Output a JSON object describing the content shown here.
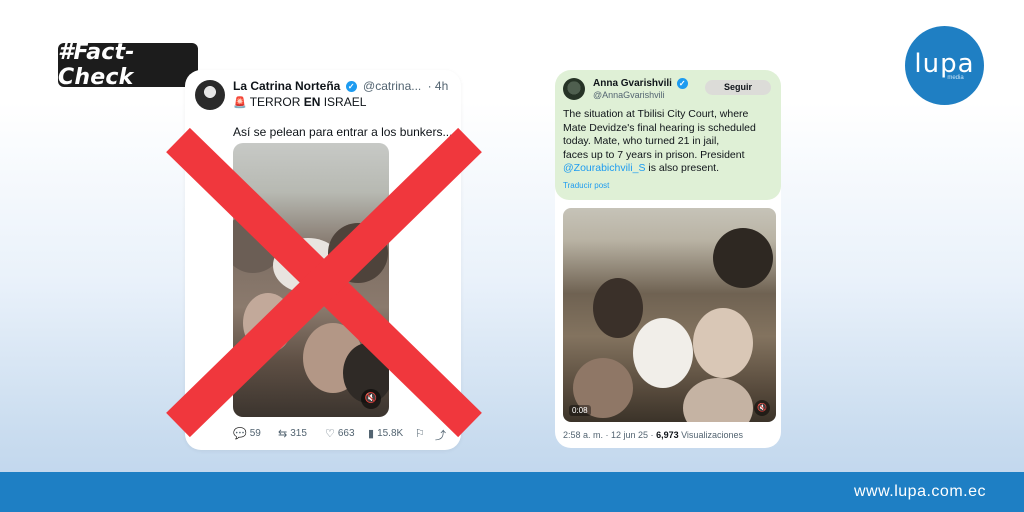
{
  "badge": {
    "label": "#Fact-Check"
  },
  "logo": {
    "name": "lupa",
    "sub": "media"
  },
  "left_post": {
    "display_name": "La Catrina Norteña",
    "handle": "@catrina...",
    "time": "· 4h",
    "line2_prefix": "TERROR ",
    "line2_bold": "EN",
    "line2_suffix": " ISRAEL",
    "body": "Así se pelean para entrar a los bunkers...",
    "replies": "59",
    "reposts": "315",
    "likes": "663",
    "views": "15.8K"
  },
  "right_post": {
    "display_name": "Anna Gvarishvili",
    "handle": "@AnnaGvarishvili",
    "follow_label": "Seguir",
    "body_lines": [
      "The situation at Tbilisi City Court, where",
      "Mate Devidze's final hearing is scheduled",
      "today. Mate, who turned 21 in jail,",
      "faces up to 7 years in prison. President"
    ],
    "mention": "@Zourabichvili_S",
    "body_tail": " is also present.",
    "translate": "Traducir post",
    "video_time": "0:08",
    "meta_time": "2:58 a. m. · 12 jun 25 · ",
    "meta_views": "6,973",
    "meta_views_label": " Visualizaciones"
  },
  "footer": {
    "url": "www.lupa.com.ec"
  },
  "colors": {
    "cross": "#f0373d",
    "brand": "#1e7fc4",
    "link": "#1d9bf0",
    "quote_bg": "#dff0d6"
  }
}
